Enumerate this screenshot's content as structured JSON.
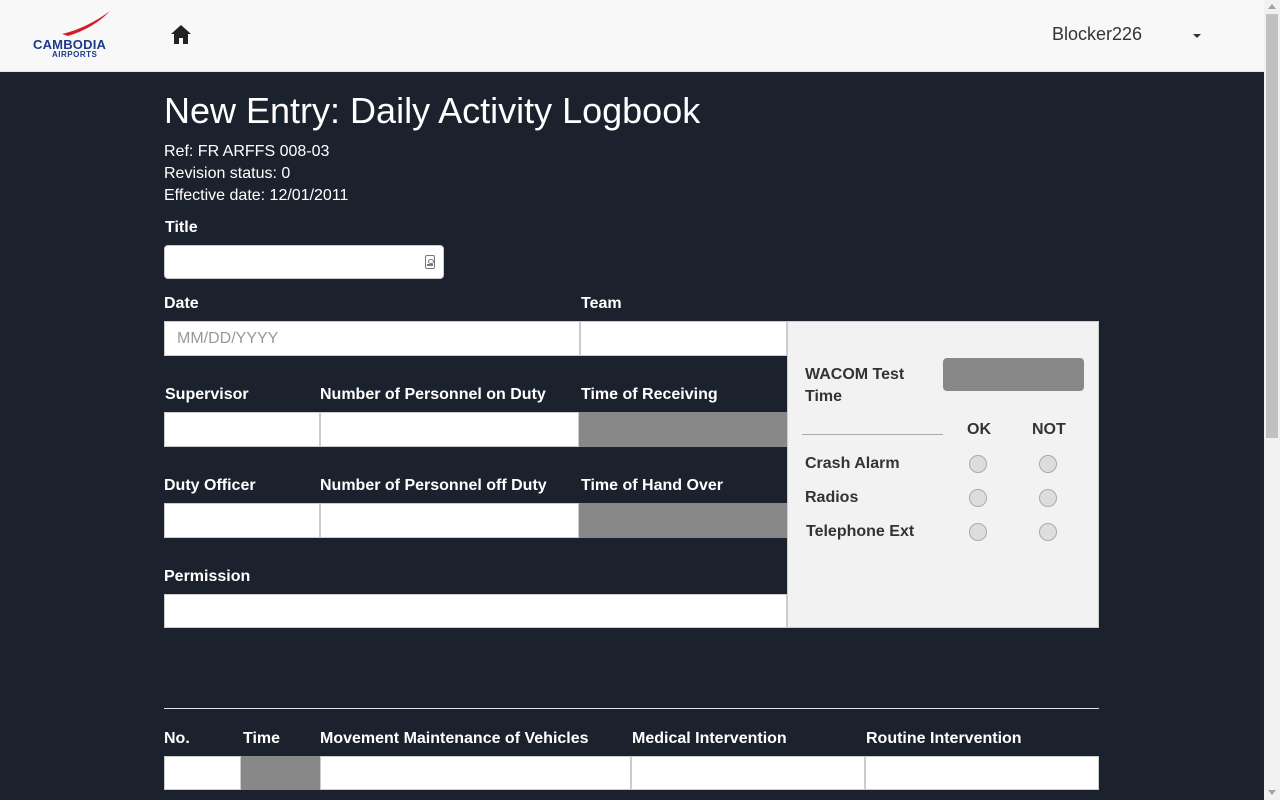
{
  "nav": {
    "logo_text": "CAMBODIA",
    "logo_subtext": "AIRPORTS",
    "user_name": "Blocker226"
  },
  "page": {
    "title": "New Entry: Daily Activity Logbook",
    "ref": "Ref: FR ARFFS 008-03",
    "revision": "Revision status: 0",
    "effective": "Effective date: 12/01/2011"
  },
  "form": {
    "title_label": "Title",
    "date_label": "Date",
    "date_placeholder": "MM/DD/YYYY",
    "team_label": "Team",
    "supervisor_label": "Supervisor",
    "personnel_on_label": "Number of Personnel on Duty",
    "receiving_label": "Time of Receiving",
    "duty_officer_label": "Duty Officer",
    "personnel_off_label": "Number of Personnel off Duty",
    "handover_label": "Time of Hand Over",
    "permission_label": "Permission"
  },
  "checks": {
    "wacom_label": "WACOM Test Time",
    "ok_label": "OK",
    "not_label": "NOT",
    "rows": [
      "Crash Alarm",
      "Radios",
      "Telephone Ext"
    ]
  },
  "table": {
    "headers": [
      "No.",
      "Time",
      "Movement Maintenance of Vehicles",
      "Medical Intervention",
      "Routine Intervention"
    ]
  },
  "colors": {
    "background": "#1c222d",
    "navbar": "#f8f8f8",
    "disabled_field": "#888888",
    "panel": "#f2f2f2"
  }
}
